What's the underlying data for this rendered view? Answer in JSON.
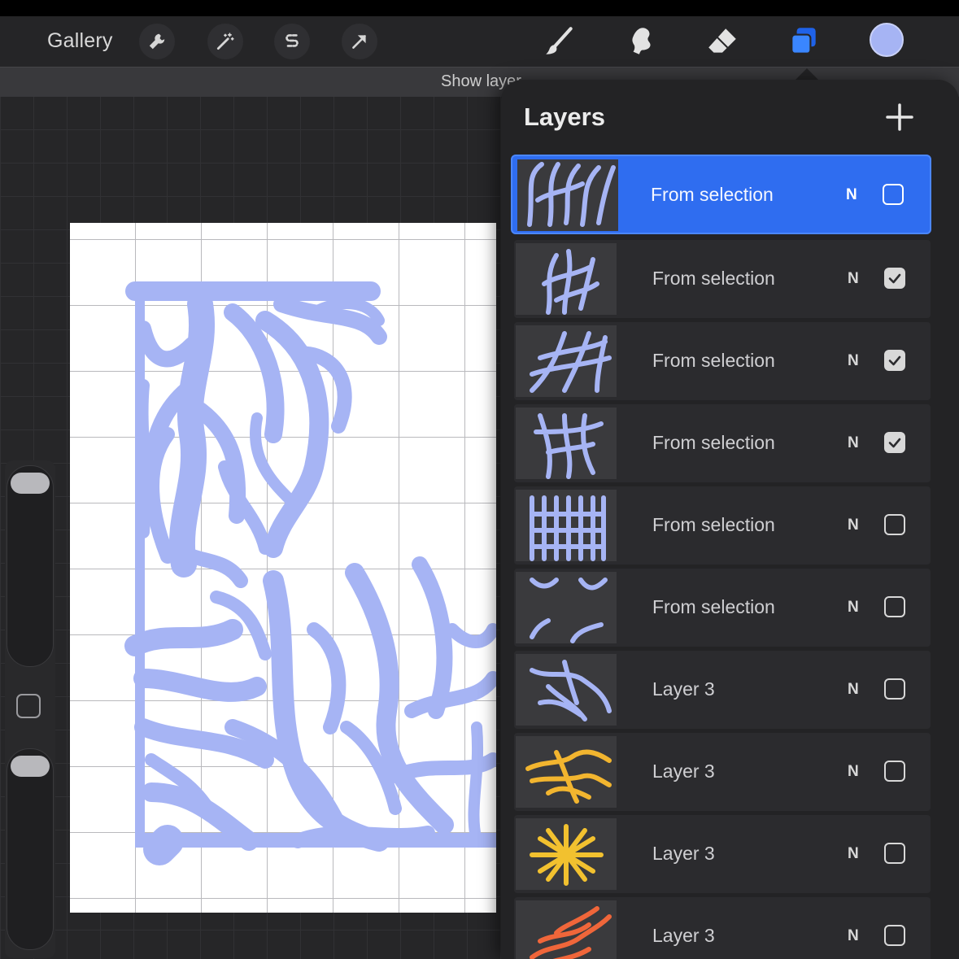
{
  "toolbar": {
    "gallery_label": "Gallery",
    "left_tools": [
      "wrench-icon",
      "magic-wand-icon",
      "selection-s-icon",
      "arrow-transform-icon"
    ],
    "right_tools": [
      "brush-icon",
      "smudge-icon",
      "eraser-icon",
      "layers-icon"
    ],
    "active_tool": "layers-icon",
    "current_color": "#a6b4f4"
  },
  "status": {
    "text": "Show layer"
  },
  "layers_panel": {
    "title": "Layers",
    "add_icon": "plus-icon",
    "layers": [
      {
        "name": "From selection",
        "blend": "N",
        "visible": false,
        "selected": true,
        "thumb_color": "#a6b4f4"
      },
      {
        "name": "From selection",
        "blend": "N",
        "visible": true,
        "selected": false,
        "thumb_color": "#a6b4f4"
      },
      {
        "name": "From selection",
        "blend": "N",
        "visible": true,
        "selected": false,
        "thumb_color": "#a6b4f4"
      },
      {
        "name": "From selection",
        "blend": "N",
        "visible": true,
        "selected": false,
        "thumb_color": "#a6b4f4"
      },
      {
        "name": "From selection",
        "blend": "N",
        "visible": false,
        "selected": false,
        "thumb_color": "#a6b4f4"
      },
      {
        "name": "From selection",
        "blend": "N",
        "visible": false,
        "selected": false,
        "thumb_color": "#a6b4f4"
      },
      {
        "name": "Layer 3",
        "blend": "N",
        "visible": false,
        "selected": false,
        "thumb_color": "#a6b4f4"
      },
      {
        "name": "Layer 3",
        "blend": "N",
        "visible": false,
        "selected": false,
        "thumb_color": "#f2b52f"
      },
      {
        "name": "Layer 3",
        "blend": "N",
        "visible": false,
        "selected": false,
        "thumb_color": "#f2c12f"
      },
      {
        "name": "Layer 3",
        "blend": "N",
        "visible": false,
        "selected": false,
        "thumb_color": "#f0663a"
      }
    ]
  },
  "colors": {
    "accent": "#2f6df0",
    "artwork": "#a6b4f4"
  }
}
